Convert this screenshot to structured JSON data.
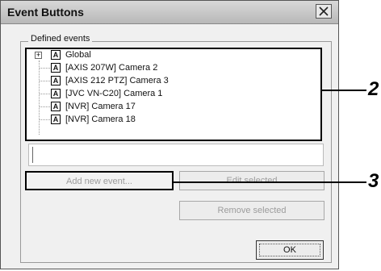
{
  "window": {
    "title": "Event Buttons"
  },
  "group": {
    "label": "Defined events"
  },
  "tree": {
    "items": [
      {
        "label": "Global",
        "expander": "+"
      },
      {
        "label": "[AXIS 207W] Camera 2"
      },
      {
        "label": "[AXIS 212 PTZ] Camera 3"
      },
      {
        "label": "[JVC VN-C20] Camera 1"
      },
      {
        "label": "[NVR] Camera 17"
      },
      {
        "label": "[NVR] Camera 18"
      }
    ],
    "item_icon_glyph": "A"
  },
  "buttons": {
    "add": "Add new event...",
    "edit": "Edit selected",
    "remove": "Remove selected",
    "ok": "OK"
  },
  "callouts": {
    "tree": "2",
    "add": "3"
  },
  "icons": {
    "close": "close-icon",
    "item": "event-button-icon",
    "expand": "plus-icon"
  },
  "colors": {
    "disabled_text": "#9c9c9c",
    "highlight_border": "#000000"
  }
}
